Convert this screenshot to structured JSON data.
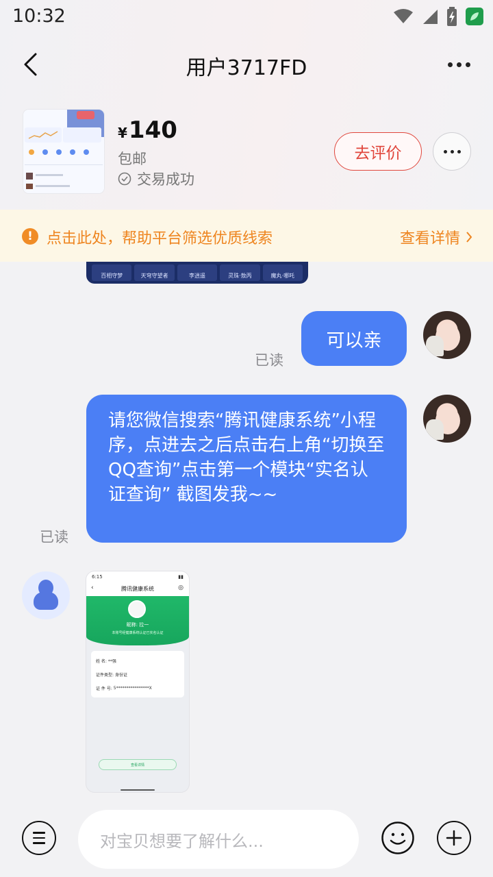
{
  "status_bar": {
    "time": "10:32"
  },
  "nav": {
    "title": "用户3717FD"
  },
  "product": {
    "currency": "¥",
    "price": "140",
    "shipping": "包邮",
    "trade_status": "交易成功",
    "review_button": "去评价"
  },
  "notice": {
    "icon_text": "!",
    "text": "点击此处，帮助平台筛选优质线索",
    "link": "查看详情"
  },
  "messages": {
    "image_fragment_labels": [
      "百相守梦",
      "天穹守望者",
      "李逍遥",
      "灵珠·敖丙",
      "魔丸·哪吒"
    ],
    "msg1": {
      "text": "可以亲",
      "read": "已读"
    },
    "msg2": {
      "text": "请您微信搜索“腾讯健康系统”小程序，点进去之后点击右上角“切换至QQ查询”点击第一个模块“实名认证查询” 截图发我~~",
      "read": "已读"
    },
    "screenshot": {
      "status_time": "6:15",
      "title": "腾讯健康系统",
      "name_line": "昵称:  拉一",
      "sub_line": "本账号经健康系统认证已实名认证",
      "rows": [
        {
          "label": "姓    名:",
          "value": "**强"
        },
        {
          "label": "证件类型:",
          "value": "身份证"
        },
        {
          "label": "证 件 号:",
          "value": "5****************X"
        }
      ],
      "button": "查看详情"
    }
  },
  "composer": {
    "placeholder": "对宝贝想要了解什么..."
  },
  "icons": {
    "back": "back-chevron-icon",
    "more": "more-dots-icon",
    "wifi": "wifi-icon",
    "signal": "signal-icon",
    "battery": "battery-charging-icon",
    "app": "leaf-app-icon",
    "check": "check-circle-icon",
    "warning": "warning-icon",
    "chevron": "chevron-right-icon",
    "menu": "menu-icon",
    "emoji": "emoji-icon",
    "plus": "plus-icon"
  },
  "colors": {
    "accent_blue": "#4b7ff5",
    "review_red": "#e0463c",
    "notice_orange": "#ee8520",
    "notice_bg": "#fdf7e6"
  }
}
